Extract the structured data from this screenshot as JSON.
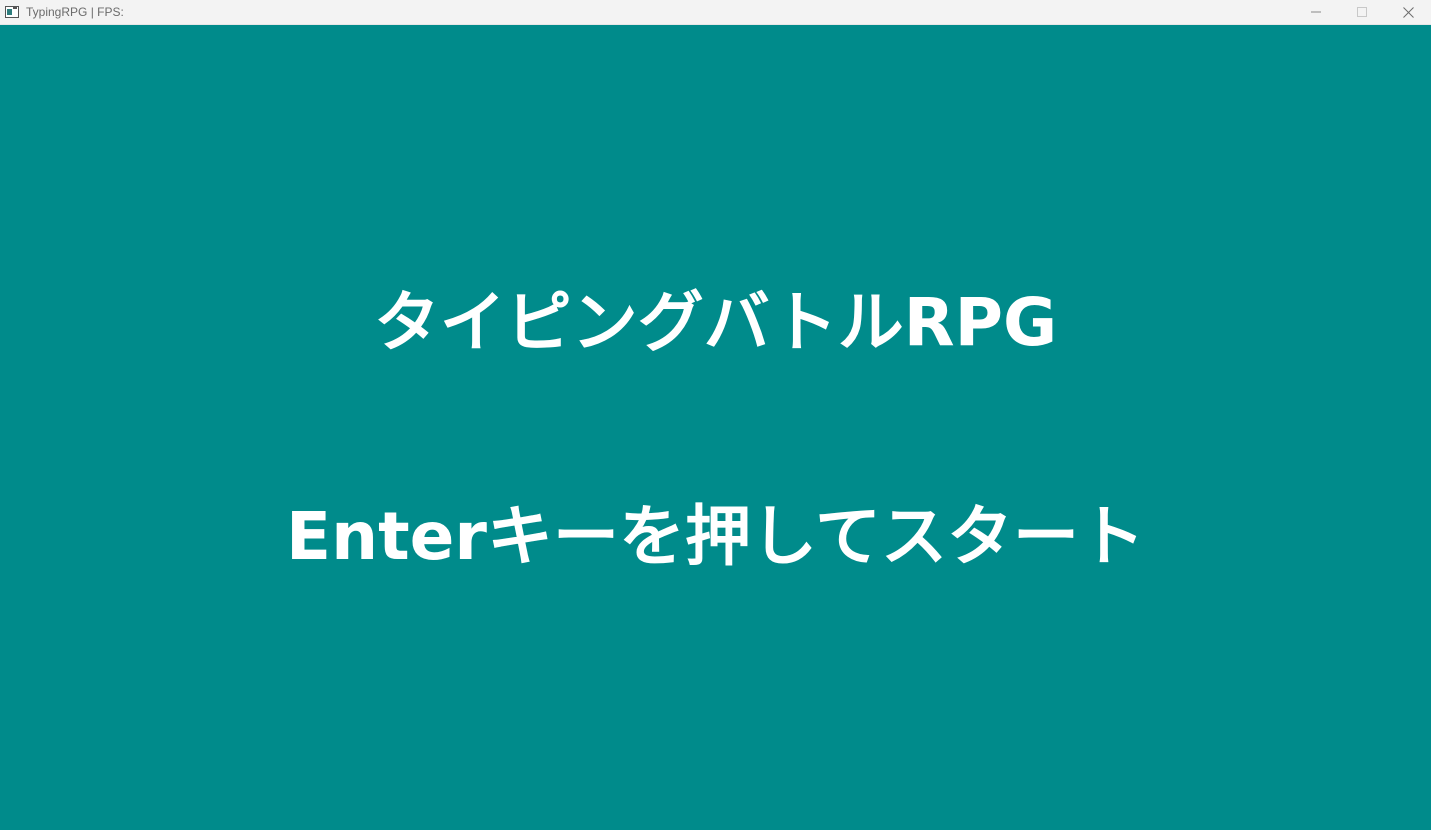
{
  "window": {
    "title": "TypingRPG | FPS:",
    "controls": {
      "minimize_icon": "minimize-icon",
      "maximize_icon": "maximize-icon",
      "close_icon": "close-icon"
    }
  },
  "game": {
    "title": "タイピングバトルRPG",
    "start_prompt": "Enterキーを押してスタート",
    "background_color": "#008b8b",
    "text_color": "#ffffff"
  }
}
